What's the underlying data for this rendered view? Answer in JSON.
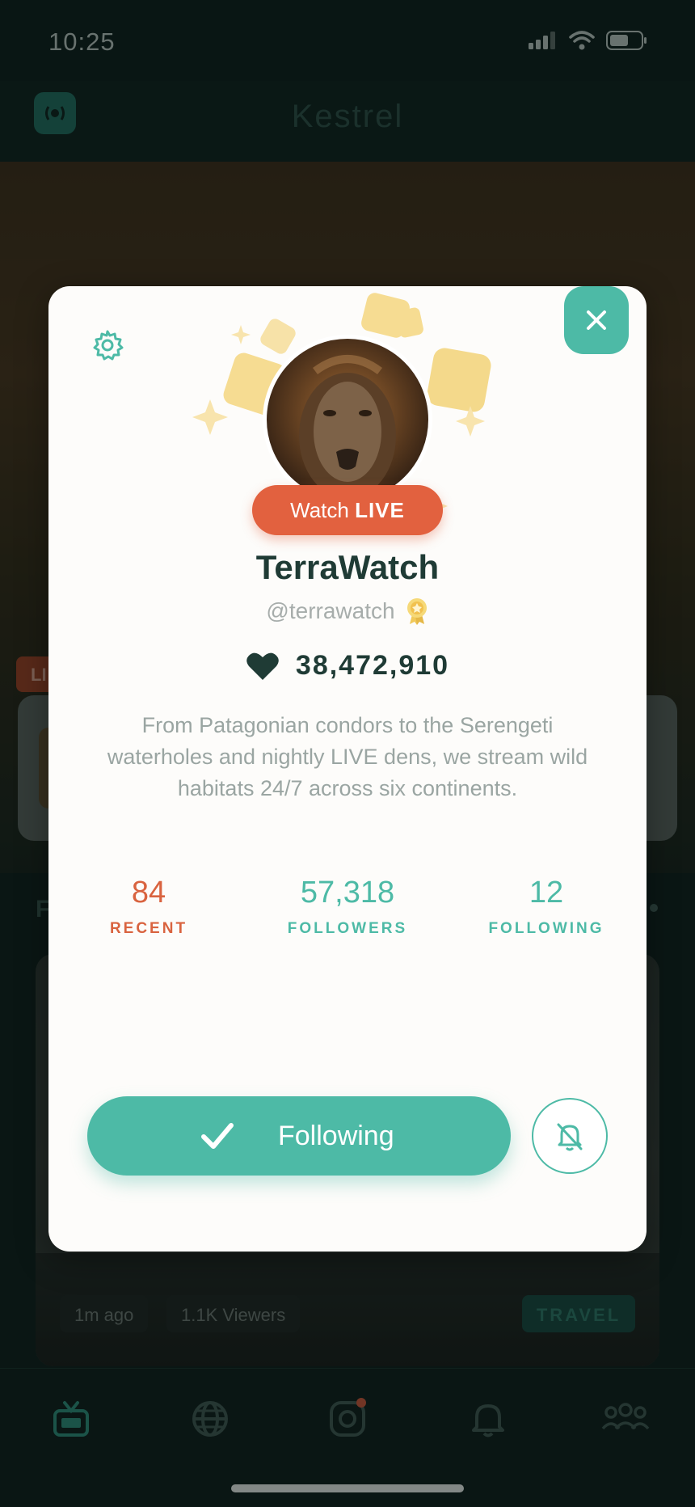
{
  "status_bar": {
    "time": "10:25"
  },
  "app": {
    "title": "Kestrel"
  },
  "background": {
    "live_tag": "LI",
    "section_letter": "F",
    "feed_card": {
      "time_ago": "1m ago",
      "viewers": "1.1K Viewers",
      "category": "TRAVEL"
    }
  },
  "profile": {
    "watch_live_prefix": "Watch",
    "watch_live_bold": "LIVE",
    "name": "TerraWatch",
    "handle": "@terrawatch",
    "likes": "38,472,910",
    "bio": "From Patagonian condors to the Serengeti waterholes and nightly LIVE dens, we stream wild habitats 24/7 across six continents.",
    "stats": [
      {
        "value": "84",
        "label": "RECENT"
      },
      {
        "value": "57,318",
        "label": "FOLLOWERS"
      },
      {
        "value": "12",
        "label": "FOLLOWING"
      }
    ],
    "following_button": "Following"
  },
  "colors": {
    "accent": "#4dbaa6",
    "live": "#e2613f",
    "dark_text": "#1f3b35"
  },
  "icons": {
    "settings": "gear-icon",
    "close": "close-icon",
    "verified": "award-badge-icon",
    "likes": "heart-icon",
    "following": "check-icon",
    "notify": "bell-off-icon"
  }
}
